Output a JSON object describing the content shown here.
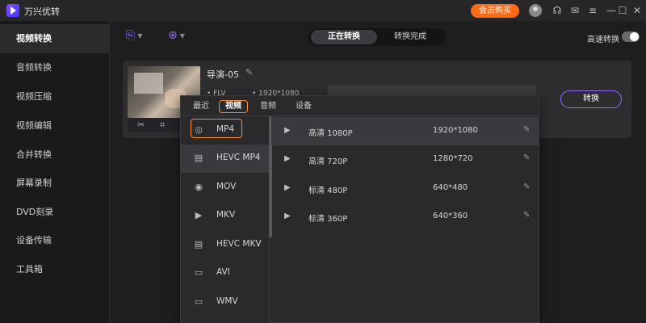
{
  "app": {
    "title": "万兴优转",
    "vip_button": "会员购买"
  },
  "window_icons": [
    "avatar-icon",
    "headset-icon",
    "mail-icon",
    "menu-icon",
    "minimize-icon",
    "maximize-icon",
    "close-icon"
  ],
  "sidebar": {
    "items": [
      {
        "label": "视频转换",
        "active": true
      },
      {
        "label": "音频转换"
      },
      {
        "label": "视频压缩"
      },
      {
        "label": "视频编辑"
      },
      {
        "label": "合并转换"
      },
      {
        "label": "屏幕录制"
      },
      {
        "label": "DVD刻录"
      },
      {
        "label": "设备传输"
      },
      {
        "label": "工具箱"
      }
    ]
  },
  "toolbar": {
    "tabs": [
      {
        "label": "正在转换",
        "active": true
      },
      {
        "label": "转换完成"
      }
    ],
    "high_speed_label": "高速转换",
    "high_speed_enabled": false
  },
  "file": {
    "name": "导演-05",
    "format": "FLV",
    "resolution": "1920*1080",
    "convert_button": "转换"
  },
  "popup": {
    "tabs": [
      {
        "label": "最近"
      },
      {
        "label": "视频",
        "active": true
      },
      {
        "label": "音频"
      },
      {
        "label": "设备"
      }
    ],
    "formats": [
      {
        "label": "MP4",
        "icon": "disc-icon",
        "selected": true
      },
      {
        "label": "HEVC MP4",
        "icon": "hevc-icon"
      },
      {
        "label": "MOV",
        "icon": "mov-icon"
      },
      {
        "label": "MKV",
        "icon": "video-icon"
      },
      {
        "label": "HEVC MKV",
        "icon": "hevc-icon"
      },
      {
        "label": "AVI",
        "icon": "film-icon"
      },
      {
        "label": "WMV",
        "icon": "film-icon"
      }
    ],
    "resolutions": [
      {
        "name": "高清 1080P",
        "size": "1920*1080",
        "selected": true
      },
      {
        "name": "高清 720P",
        "size": "1280*720"
      },
      {
        "name": "标清 480P",
        "size": "640*480"
      },
      {
        "name": "标清 360P",
        "size": "640*360"
      }
    ]
  },
  "colors": {
    "accent": "#8f6bff",
    "orange": "#ff8a2e",
    "vip": "#ff6a16"
  }
}
